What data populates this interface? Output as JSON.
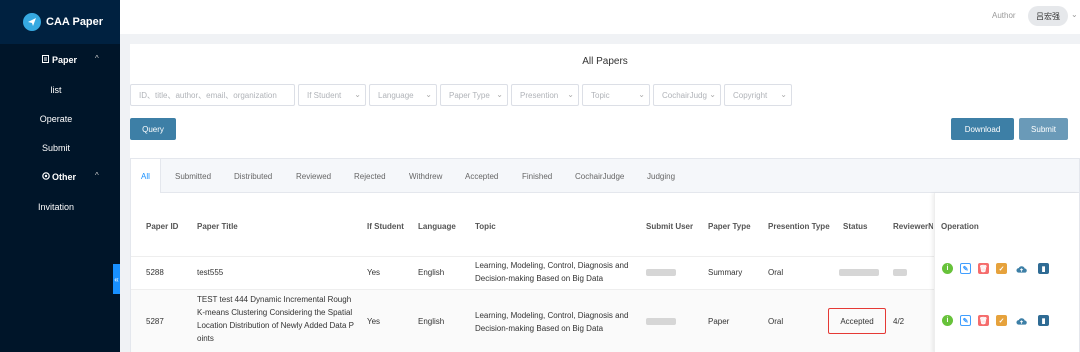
{
  "app": {
    "title": "CAA Paper"
  },
  "sidebar": {
    "group_paper": "Paper",
    "items": [
      "list",
      "Operate",
      "Submit"
    ],
    "group_other": "Other",
    "other_items": [
      "Invitation"
    ],
    "collapse": "«"
  },
  "header": {
    "role": "Author",
    "user": "吕宏强"
  },
  "main": {
    "title": "All Papers",
    "search_placeholder": "ID、title、author、email、organization",
    "filters": [
      "If Student",
      "Language",
      "Paper Type",
      "Presention",
      "Topic",
      "CochairJudg",
      "Copyright"
    ],
    "query_label": "Query",
    "download_label": "Download",
    "submit_label": "Submit",
    "tabs": [
      "All",
      "Submitted",
      "Distributed",
      "Reviewed",
      "Rejected",
      "Withdrew",
      "Accepted",
      "Finished",
      "CochairJudge",
      "Judging"
    ],
    "columns": [
      "Paper ID",
      "Paper Title",
      "If Student",
      "Language",
      "Topic",
      "Submit User",
      "Paper Type",
      "Presention Type",
      "Status",
      "ReviewerN",
      "Operation"
    ],
    "rows": [
      {
        "id": "5288",
        "title": [
          "test555"
        ],
        "student": "Yes",
        "language": "English",
        "topic": [
          "Learning, Modeling, Control, Diagnosis and",
          "Decision-making Based on Big Data"
        ],
        "type": "Summary",
        "presention": "Oral",
        "status": "",
        "reviewers": ""
      },
      {
        "id": "5287",
        "title": [
          "TEST test 444 Dynamic Incremental Rough",
          "K-means Clustering Considering the Spatial",
          "Location Distribution of Newly Added Data P",
          "oints"
        ],
        "student": "Yes",
        "language": "English",
        "topic": [
          "Learning, Modeling, Control, Diagnosis and",
          "Decision-making Based on Big Data"
        ],
        "type": "Paper",
        "presention": "Oral",
        "status": "Accepted",
        "reviewers": "4/2"
      }
    ]
  },
  "colors": {
    "sidebar": "#001529",
    "accent": "#1890ff",
    "button": "#3d7fa6",
    "accepted_border": "#e53935"
  },
  "operation_icons": [
    "info-icon",
    "edit-icon",
    "delete-icon",
    "clipboard-icon",
    "cloud-upload-icon",
    "book-icon"
  ]
}
